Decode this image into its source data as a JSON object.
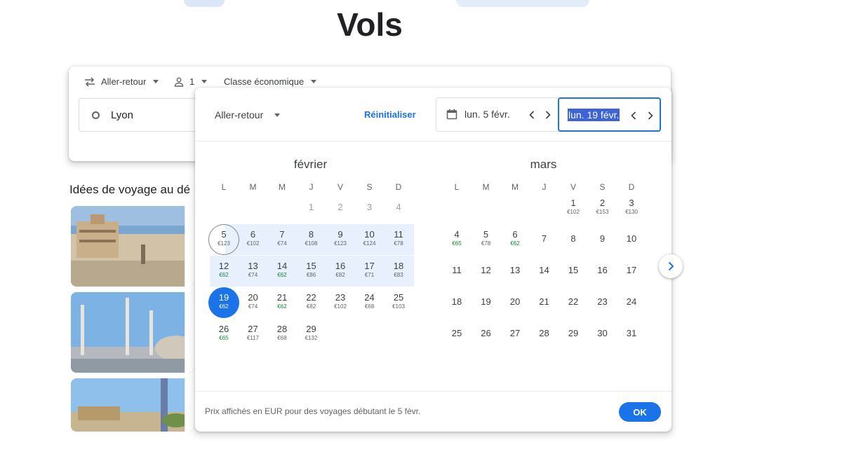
{
  "page": {
    "title": "Vols"
  },
  "search": {
    "trip_type": "Aller-retour",
    "passengers": "1",
    "cabin": "Classe économique",
    "origin": "Lyon"
  },
  "ideas": {
    "title": "Idées de voyage au dé"
  },
  "picker": {
    "trip_type": "Aller-retour",
    "reset_label": "Réinitialiser",
    "depart_date": "lun. 5 févr.",
    "return_date": "lun. 19 févr.",
    "weekdays": [
      "L",
      "M",
      "M",
      "J",
      "V",
      "S",
      "D"
    ],
    "months": [
      {
        "name": "février",
        "days": [
          {
            "d": "1",
            "p": "",
            "col": 3,
            "row": 0,
            "past": true
          },
          {
            "d": "2",
            "p": "",
            "col": 4,
            "row": 0,
            "past": true
          },
          {
            "d": "3",
            "p": "",
            "col": 5,
            "row": 0,
            "past": true
          },
          {
            "d": "4",
            "p": "",
            "col": 6,
            "row": 0,
            "past": true
          },
          {
            "d": "5",
            "p": "€123",
            "col": 0,
            "row": 1,
            "state": "start"
          },
          {
            "d": "6",
            "p": "€102",
            "col": 1,
            "row": 1,
            "state": "range"
          },
          {
            "d": "7",
            "p": "€74",
            "col": 2,
            "row": 1,
            "state": "range"
          },
          {
            "d": "8",
            "p": "€108",
            "col": 3,
            "row": 1,
            "state": "range"
          },
          {
            "d": "9",
            "p": "€123",
            "col": 4,
            "row": 1,
            "state": "range"
          },
          {
            "d": "10",
            "p": "€124",
            "col": 5,
            "row": 1,
            "state": "range"
          },
          {
            "d": "11",
            "p": "€78",
            "col": 6,
            "row": 1,
            "state": "range"
          },
          {
            "d": "12",
            "p": "€62",
            "col": 0,
            "row": 2,
            "state": "range",
            "low": true
          },
          {
            "d": "13",
            "p": "€74",
            "col": 1,
            "row": 2,
            "state": "range"
          },
          {
            "d": "14",
            "p": "€62",
            "col": 2,
            "row": 2,
            "state": "range",
            "low": true
          },
          {
            "d": "15",
            "p": "€86",
            "col": 3,
            "row": 2,
            "state": "range"
          },
          {
            "d": "16",
            "p": "€82",
            "col": 4,
            "row": 2,
            "state": "range"
          },
          {
            "d": "17",
            "p": "€71",
            "col": 5,
            "row": 2,
            "state": "range"
          },
          {
            "d": "18",
            "p": "€83",
            "col": 6,
            "row": 2,
            "state": "range"
          },
          {
            "d": "19",
            "p": "€62",
            "col": 0,
            "row": 3,
            "state": "end",
            "low": true
          },
          {
            "d": "20",
            "p": "€74",
            "col": 1,
            "row": 3
          },
          {
            "d": "21",
            "p": "€62",
            "col": 2,
            "row": 3,
            "low": true
          },
          {
            "d": "22",
            "p": "€82",
            "col": 3,
            "row": 3
          },
          {
            "d": "23",
            "p": "€102",
            "col": 4,
            "row": 3
          },
          {
            "d": "24",
            "p": "€68",
            "col": 5,
            "row": 3
          },
          {
            "d": "25",
            "p": "€103",
            "col": 6,
            "row": 3
          },
          {
            "d": "26",
            "p": "€65",
            "col": 0,
            "row": 4,
            "low": true
          },
          {
            "d": "27",
            "p": "€117",
            "col": 1,
            "row": 4
          },
          {
            "d": "28",
            "p": "€68",
            "col": 2,
            "row": 4
          },
          {
            "d": "29",
            "p": "€132",
            "col": 3,
            "row": 4
          }
        ]
      },
      {
        "name": "mars",
        "days": [
          {
            "d": "1",
            "p": "€102",
            "col": 4,
            "row": 0
          },
          {
            "d": "2",
            "p": "€153",
            "col": 5,
            "row": 0
          },
          {
            "d": "3",
            "p": "€130",
            "col": 6,
            "row": 0
          },
          {
            "d": "4",
            "p": "€65",
            "col": 0,
            "row": 1,
            "low": true
          },
          {
            "d": "5",
            "p": "€78",
            "col": 1,
            "row": 1
          },
          {
            "d": "6",
            "p": "€62",
            "col": 2,
            "row": 1,
            "low": true
          },
          {
            "d": "7",
            "p": "",
            "col": 3,
            "row": 1
          },
          {
            "d": "8",
            "p": "",
            "col": 4,
            "row": 1
          },
          {
            "d": "9",
            "p": "",
            "col": 5,
            "row": 1
          },
          {
            "d": "10",
            "p": "",
            "col": 6,
            "row": 1
          },
          {
            "d": "11",
            "p": "",
            "col": 0,
            "row": 2
          },
          {
            "d": "12",
            "p": "",
            "col": 1,
            "row": 2
          },
          {
            "d": "13",
            "p": "",
            "col": 2,
            "row": 2
          },
          {
            "d": "14",
            "p": "",
            "col": 3,
            "row": 2
          },
          {
            "d": "15",
            "p": "",
            "col": 4,
            "row": 2
          },
          {
            "d": "16",
            "p": "",
            "col": 5,
            "row": 2
          },
          {
            "d": "17",
            "p": "",
            "col": 6,
            "row": 2
          },
          {
            "d": "18",
            "p": "",
            "col": 0,
            "row": 3
          },
          {
            "d": "19",
            "p": "",
            "col": 1,
            "row": 3
          },
          {
            "d": "20",
            "p": "",
            "col": 2,
            "row": 3
          },
          {
            "d": "21",
            "p": "",
            "col": 3,
            "row": 3
          },
          {
            "d": "22",
            "p": "",
            "col": 4,
            "row": 3
          },
          {
            "d": "23",
            "p": "",
            "col": 5,
            "row": 3
          },
          {
            "d": "24",
            "p": "",
            "col": 6,
            "row": 3
          },
          {
            "d": "25",
            "p": "",
            "col": 0,
            "row": 4
          },
          {
            "d": "26",
            "p": "",
            "col": 1,
            "row": 4
          },
          {
            "d": "27",
            "p": "",
            "col": 2,
            "row": 4
          },
          {
            "d": "28",
            "p": "",
            "col": 3,
            "row": 4
          },
          {
            "d": "29",
            "p": "",
            "col": 4,
            "row": 4
          },
          {
            "d": "30",
            "p": "",
            "col": 5,
            "row": 4
          },
          {
            "d": "31",
            "p": "",
            "col": 6,
            "row": 4
          }
        ]
      }
    ],
    "footer_note": "Prix affichés en EUR pour des voyages débutant le 5 févr.",
    "ok_label": "OK"
  },
  "colors": {
    "accent": "#1a73e8",
    "range": "#e8f0fe",
    "low_price": "#188038"
  }
}
